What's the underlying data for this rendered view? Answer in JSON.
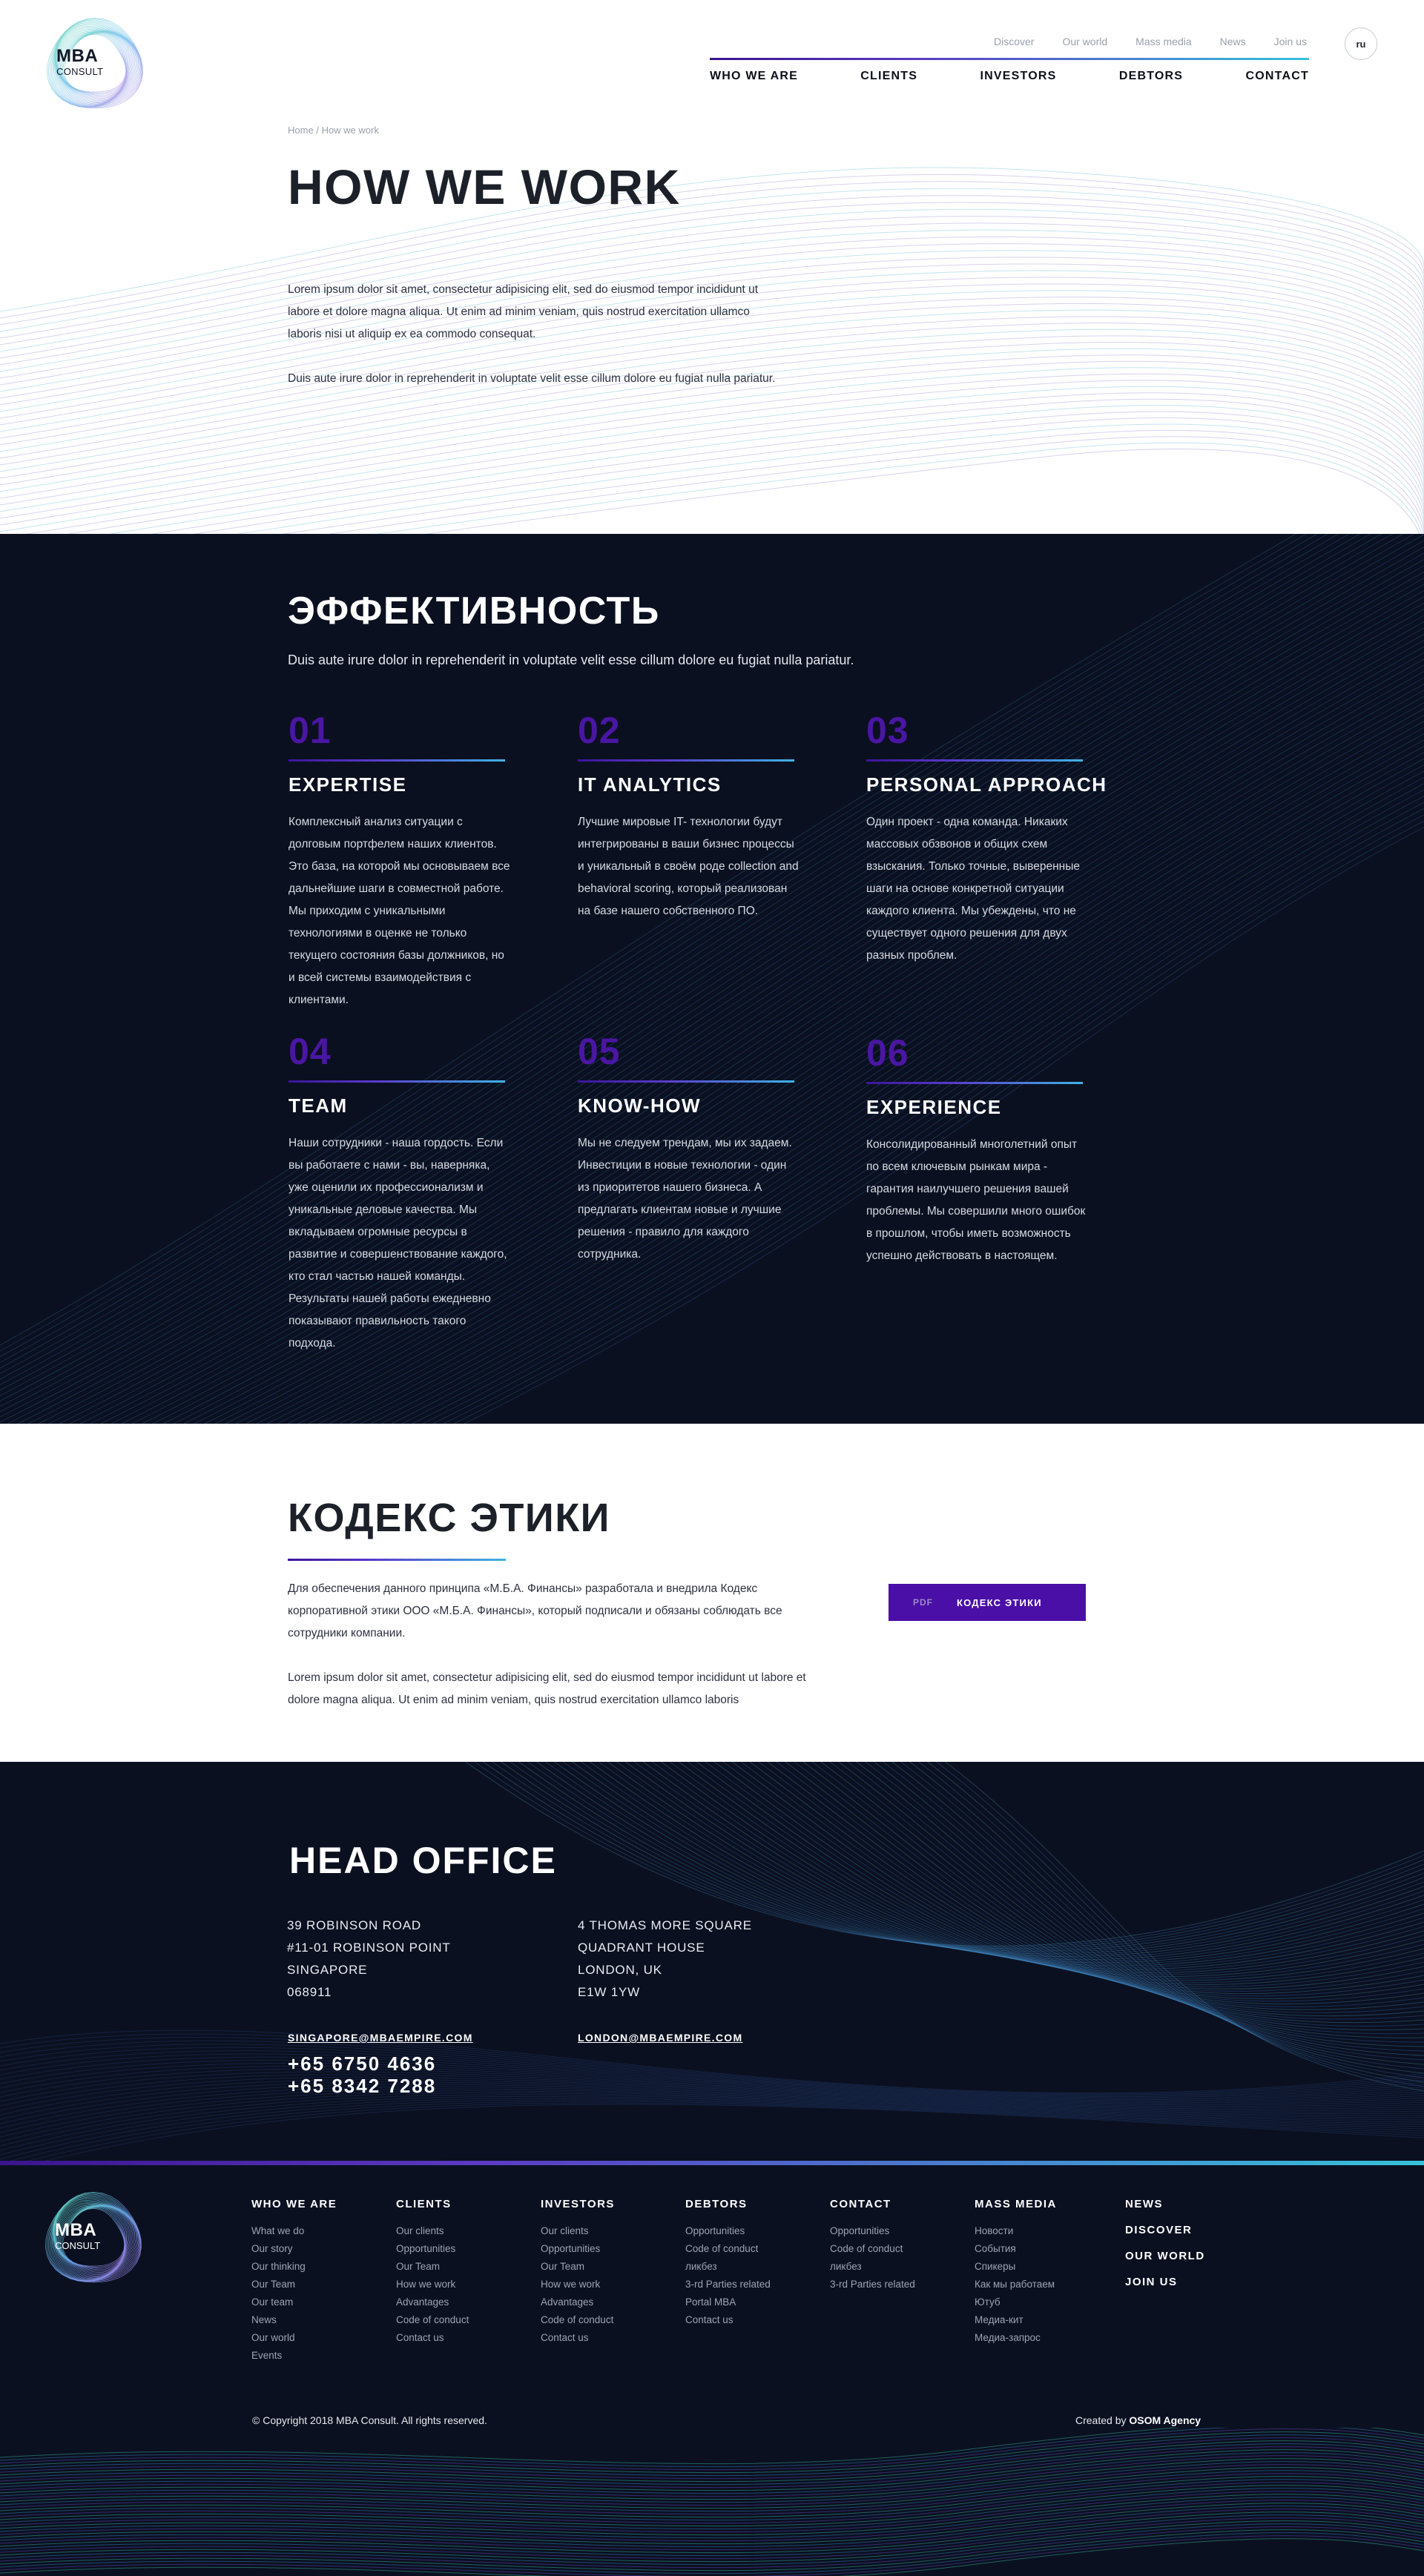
{
  "brand": {
    "mba": "MBA",
    "consult": "CONSULT"
  },
  "topnav": [
    "Discover",
    "Our world",
    "Mass media",
    "News",
    "Join us"
  ],
  "lang": "ru",
  "mainnav": [
    "WHO WE ARE",
    "CLIENTS",
    "INVESTORS",
    "DEBTORS",
    "CONTACT"
  ],
  "breadcrumb": {
    "home": "Home",
    "sep": "/",
    "current": "How we work"
  },
  "hero": {
    "title": "HOW WE WORK",
    "p1": "Lorem ipsum dolor sit amet, consectetur adipisicing elit, sed do eiusmod tempor incididunt ut labore et dolore magna aliqua. Ut enim ad minim veniam, quis nostrud exercitation ullamco laboris nisi ut aliquip ex ea commodo consequat.",
    "p2": "Duis aute irure dolor in reprehenderit in voluptate velit esse cillum dolore eu fugiat nulla pariatur."
  },
  "efficiency": {
    "title": "ЭФФЕКТИВНОСТЬ",
    "subtitle": "Duis aute irure dolor in reprehenderit in voluptate velit esse cillum dolore eu fugiat nulla pariatur.",
    "cards": [
      {
        "num": "01",
        "title": "EXPERTISE",
        "text": "Комплексный анализ ситуации с долговым портфелем наших клиентов. Это база, на которой мы основываем все дальнейшие шаги в совместной работе. Мы приходим с уникальными технологиями в оценке не только текущего состояния базы должников, но и всей системы взаимодействия с клиентами."
      },
      {
        "num": "02",
        "title": "IT ANALYTICS",
        "text": "Лучшие мировые IT- технологии будут интегрированы в ваши бизнес процессы и уникальный в своём роде collection and behavioral scoring, который реализован на базе нашего собственного ПО."
      },
      {
        "num": "03",
        "title": "PERSONAL APPROACH",
        "text": "Один проект - одна команда. Никаких массовых обзвонов и общих схем взыскания. Только точные, выверенные шаги на основе конкретной ситуации каждого клиента. Мы убеждены, что не существует одного решения для двух разных проблем."
      },
      {
        "num": "04",
        "title": "TEAM",
        "text": "Наши сотрудники - наша гордость. Если вы работаете с нами - вы, наверняка, уже оценили их профессионализм и уникальные деловые качества. Мы вкладываем огромные ресурсы в развитие и совершенствование каждого, кто стал частью нашей команды. Результаты нашей работы ежедневно показывают правильность такого подхода."
      },
      {
        "num": "05",
        "title": "KNOW-HOW",
        "text": "Мы не следуем трендам, мы их задаем. Инвестиции в новые технологии - один из приоритетов нашего бизнеса. А предлагать клиентам новые и лучшие решения - правило для каждого сотрудника."
      },
      {
        "num": "06",
        "title": "EXPERIENCE",
        "text": "Консолидированный многолетний опыт по всем ключевым рынкам мира - гарантия наилучшего решения вашей проблемы. Мы совершили много ошибок в прошлом, чтобы иметь возможность успешно действовать в настоящем."
      }
    ]
  },
  "ethics": {
    "title": "КОДЕКС ЭТИКИ",
    "p1": "Для обеспечения данного принципа «М.Б.А. Финансы» разработала и внедрила Кодекс корпоративной этики ООО «М.Б.А. Финансы», который подписали и обязаны соблюдать все сотрудники компании.",
    "p2": "Lorem ipsum dolor sit amet, consectetur adipisicing elit, sed do eiusmod tempor incididunt ut labore et dolore magna aliqua. Ut enim ad minim veniam, quis nostrud exercitation ullamco laboris",
    "button": {
      "tag": "PDF",
      "label": "КОДЕКС ЭТИКИ"
    }
  },
  "office": {
    "title": "HEAD OFFICE",
    "singapore": {
      "lines": [
        "39 ROBINSON ROAD",
        "#11-01 ROBINSON POINT",
        "SINGAPORE",
        "068911"
      ],
      "email": "SINGAPORE@MBAEMPIRE.COM",
      "phones": [
        "+65 6750 4636",
        "+65 8342 7288"
      ]
    },
    "london": {
      "lines": [
        "4 THOMAS MORE SQUARE",
        "QUADRANT HOUSE",
        "LONDON, UK",
        "E1W 1YW"
      ],
      "email": "LONDON@MBAEMPIRE.COM"
    }
  },
  "footer": {
    "columns": [
      {
        "title": "WHO WE ARE",
        "links": [
          "What we do",
          "Our story",
          "Our thinking",
          "Our Team",
          "Our team",
          "News",
          "Our world",
          "Events"
        ]
      },
      {
        "title": "CLIENTS",
        "links": [
          "Our clients",
          "Opportunities",
          "Our Team",
          "How we work",
          "Advantages",
          "Code of conduct",
          "Contact us"
        ]
      },
      {
        "title": "INVESTORS",
        "links": [
          "Our clients",
          "Opportunities",
          "Our Team",
          "How we work",
          "Advantages",
          "Code of conduct",
          "Contact us"
        ]
      },
      {
        "title": "DEBTORS",
        "links": [
          "Opportunities",
          "Code of conduct",
          "ликбез",
          "3-rd Parties related",
          "Portal MBA",
          "Contact us"
        ]
      },
      {
        "title": "CONTACT",
        "links": [
          "Opportunities",
          "Code of conduct",
          "ликбез",
          "3-rd Parties related"
        ]
      },
      {
        "title": "MASS MEDIA",
        "links": [
          "Новости",
          "События",
          "Спикеры",
          "Как мы работаем",
          "Ютуб",
          "Медиа-кит",
          "Медиа-запрос"
        ]
      }
    ],
    "main_links": [
      "NEWS",
      "DISCOVER",
      "OUR WORLD",
      "JOIN US"
    ],
    "copyright": "© Copyright 2018 MBA Consult. All rights reserved.",
    "created_prefix": "Created by",
    "created_by": "OSOM Agency"
  },
  "colors": {
    "dark_bg": "#0b1020",
    "accent_purple": "#4a0fa6",
    "number_purple": "#4a16a3",
    "gradient_cyan": "#36c2d9"
  }
}
